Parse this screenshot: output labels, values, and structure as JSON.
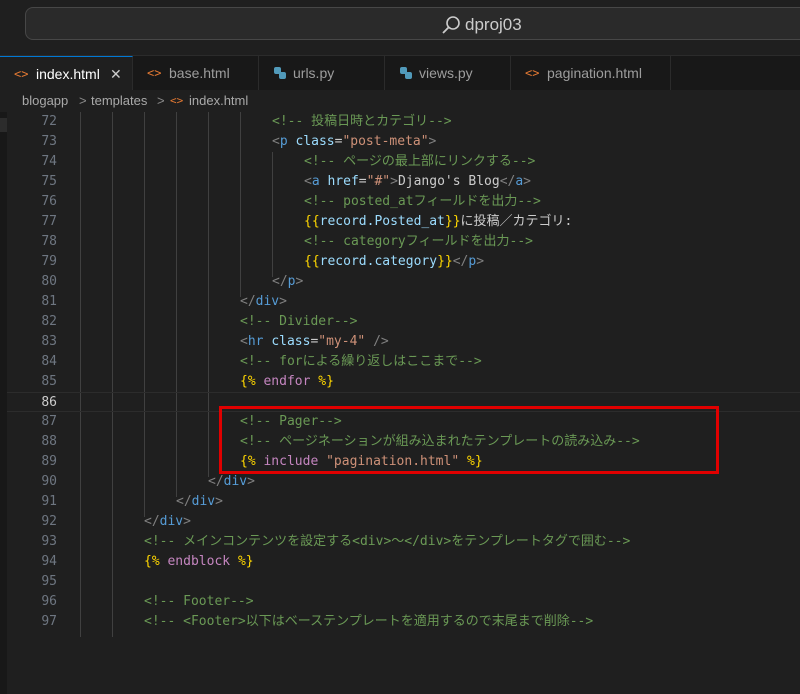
{
  "title_bar": {
    "search_text": "dproj03"
  },
  "tabs": [
    {
      "label": "index.html",
      "kind": "html",
      "active": true,
      "close": "✕"
    },
    {
      "label": "base.html",
      "kind": "html"
    },
    {
      "label": "urls.py",
      "kind": "py"
    },
    {
      "label": "views.py",
      "kind": "py"
    },
    {
      "label": "pagination.html",
      "kind": "html"
    }
  ],
  "breadcrumb": {
    "folder1": "blogapp",
    "folder2": "templates",
    "file": "index.html",
    "sep": ">",
    "html_icon": "<>"
  },
  "icons": {
    "html": "<>",
    "py": "python-icon"
  },
  "colors": {
    "comment": "#6a9955",
    "tag": "#569cd6",
    "attr": "#9cdcfe",
    "string": "#ce9178",
    "brace": "#ffd700",
    "keyword": "#c586c0",
    "highlight_box": "#e00000"
  },
  "editor": {
    "current_line": 86,
    "lines": [
      {
        "n": "72",
        "tokens": [
          [
            "c",
            "<!-- 投稿日時とカテゴリ-->"
          ]
        ]
      },
      {
        "n": "73",
        "tokens": [
          [
            "p",
            "<"
          ],
          [
            "t",
            "p"
          ],
          [
            "w",
            " "
          ],
          [
            "a",
            "class"
          ],
          [
            "w",
            "="
          ],
          [
            "s",
            "\"post-meta\""
          ],
          [
            "p",
            ">"
          ]
        ]
      },
      {
        "n": "74",
        "tokens": [
          [
            "c",
            "<!-- ページの最上部にリンクする-->"
          ]
        ]
      },
      {
        "n": "75",
        "tokens": [
          [
            "p",
            "<"
          ],
          [
            "t",
            "a"
          ],
          [
            "w",
            " "
          ],
          [
            "a",
            "href"
          ],
          [
            "w",
            "="
          ],
          [
            "s",
            "\"#\""
          ],
          [
            "p",
            ">"
          ],
          [
            "w",
            "Django's Blog"
          ],
          [
            "p",
            "</"
          ],
          [
            "t",
            "a"
          ],
          [
            "p",
            ">"
          ]
        ]
      },
      {
        "n": "76",
        "tokens": [
          [
            "c",
            "<!-- posted_atフィールドを出力-->"
          ]
        ]
      },
      {
        "n": "77",
        "tokens": [
          [
            "y",
            "{{"
          ],
          [
            "v",
            "record.Posted_at"
          ],
          [
            "y",
            "}}"
          ],
          [
            "w",
            "に投稿／カテゴリ:"
          ]
        ]
      },
      {
        "n": "78",
        "tokens": [
          [
            "c",
            "<!-- categoryフィールドを出力-->"
          ]
        ]
      },
      {
        "n": "79",
        "tokens": [
          [
            "y",
            "{{"
          ],
          [
            "v",
            "record.category"
          ],
          [
            "y",
            "}}"
          ],
          [
            "p",
            "</"
          ],
          [
            "t",
            "p"
          ],
          [
            "p",
            ">"
          ]
        ]
      },
      {
        "n": "80",
        "tokens": [
          [
            "p",
            "</"
          ],
          [
            "t",
            "p"
          ],
          [
            "p",
            ">"
          ]
        ]
      },
      {
        "n": "81",
        "tokens": [
          [
            "p",
            "</"
          ],
          [
            "t",
            "div"
          ],
          [
            "p",
            ">"
          ]
        ]
      },
      {
        "n": "82",
        "tokens": [
          [
            "c",
            "<!-- Divider-->"
          ]
        ]
      },
      {
        "n": "83",
        "tokens": [
          [
            "p",
            "<"
          ],
          [
            "t",
            "hr"
          ],
          [
            "w",
            " "
          ],
          [
            "a",
            "class"
          ],
          [
            "w",
            "="
          ],
          [
            "s",
            "\"my-4\""
          ],
          [
            "w",
            " "
          ],
          [
            "p",
            "/>"
          ]
        ]
      },
      {
        "n": "84",
        "tokens": [
          [
            "c",
            "<!-- forによる繰り返しはここまで-->"
          ]
        ]
      },
      {
        "n": "85",
        "tokens": [
          [
            "y",
            "{%"
          ],
          [
            "w",
            " "
          ],
          [
            "k",
            "endfor"
          ],
          [
            "w",
            " "
          ],
          [
            "y",
            "%}"
          ]
        ]
      },
      {
        "n": "86",
        "tokens": []
      },
      {
        "n": "87",
        "tokens": [
          [
            "c",
            "<!-- Pager-->"
          ]
        ]
      },
      {
        "n": "88",
        "tokens": [
          [
            "c",
            "<!-- ページネーションが組み込まれたテンプレートの読み込み-->"
          ]
        ]
      },
      {
        "n": "89",
        "tokens": [
          [
            "y",
            "{%"
          ],
          [
            "w",
            " "
          ],
          [
            "k",
            "include"
          ],
          [
            "w",
            " "
          ],
          [
            "s",
            "\"pagination.html\""
          ],
          [
            "w",
            " "
          ],
          [
            "y",
            "%}"
          ]
        ]
      },
      {
        "n": "90",
        "tokens": [
          [
            "p",
            "</"
          ],
          [
            "t",
            "div"
          ],
          [
            "p",
            ">"
          ]
        ]
      },
      {
        "n": "91",
        "tokens": [
          [
            "p",
            "</"
          ],
          [
            "t",
            "div"
          ],
          [
            "p",
            ">"
          ]
        ]
      },
      {
        "n": "92",
        "tokens": [
          [
            "p",
            "</"
          ],
          [
            "t",
            "div"
          ],
          [
            "p",
            ">"
          ]
        ]
      },
      {
        "n": "93",
        "tokens": [
          [
            "c",
            "<!-- メインコンテンツを設定する<div>〜</div>をテンプレートタグで囲む-->"
          ]
        ]
      },
      {
        "n": "94",
        "tokens": [
          [
            "y",
            "{%"
          ],
          [
            "w",
            " "
          ],
          [
            "k",
            "endblock"
          ],
          [
            "w",
            " "
          ],
          [
            "y",
            "%}"
          ]
        ]
      },
      {
        "n": "95",
        "tokens": []
      },
      {
        "n": "96",
        "tokens": [
          [
            "c",
            "<!-- Footer-->"
          ]
        ]
      },
      {
        "n": "97",
        "tokens": [
          [
            "c",
            "<!-- <Footer>以下はベーステンプレートを適用するので末尾まで削除-->"
          ]
        ]
      }
    ]
  }
}
